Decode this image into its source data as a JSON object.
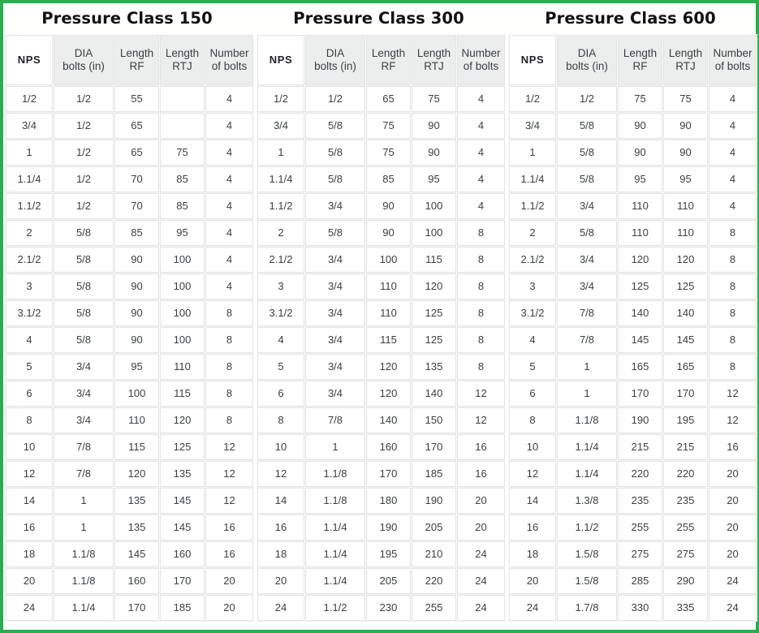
{
  "columns": [
    "NPS",
    "DIA bolts (in)",
    "Length RF",
    "Length RTJ",
    "Number of bolts"
  ],
  "column_lines": [
    {
      "line1": "NPS",
      "line2": ""
    },
    {
      "line1": "DIA",
      "line2": "bolts (in)"
    },
    {
      "line1": "Length",
      "line2": "RF"
    },
    {
      "line1": "Length",
      "line2": "RTJ"
    },
    {
      "line1": "Number",
      "line2": "of bolts"
    }
  ],
  "colors": {
    "page_border_green": "#28af4d",
    "header_background": "#eceded",
    "cell_border": "#e4e4e4",
    "text": "#3c4043",
    "title_text": "#111111"
  },
  "tables": [
    {
      "title": "Pressure Class 150",
      "rows": [
        [
          "1/2",
          "1/2",
          "55",
          "",
          "4"
        ],
        [
          "3/4",
          "1/2",
          "65",
          "",
          "4"
        ],
        [
          "1",
          "1/2",
          "65",
          "75",
          "4"
        ],
        [
          "1.1/4",
          "1/2",
          "70",
          "85",
          "4"
        ],
        [
          "1.1/2",
          "1/2",
          "70",
          "85",
          "4"
        ],
        [
          "2",
          "5/8",
          "85",
          "95",
          "4"
        ],
        [
          "2.1/2",
          "5/8",
          "90",
          "100",
          "4"
        ],
        [
          "3",
          "5/8",
          "90",
          "100",
          "4"
        ],
        [
          "3.1/2",
          "5/8",
          "90",
          "100",
          "8"
        ],
        [
          "4",
          "5/8",
          "90",
          "100",
          "8"
        ],
        [
          "5",
          "3/4",
          "95",
          "110",
          "8"
        ],
        [
          "6",
          "3/4",
          "100",
          "115",
          "8"
        ],
        [
          "8",
          "3/4",
          "110",
          "120",
          "8"
        ],
        [
          "10",
          "7/8",
          "115",
          "125",
          "12"
        ],
        [
          "12",
          "7/8",
          "120",
          "135",
          "12"
        ],
        [
          "14",
          "1",
          "135",
          "145",
          "12"
        ],
        [
          "16",
          "1",
          "135",
          "145",
          "16"
        ],
        [
          "18",
          "1.1/8",
          "145",
          "160",
          "16"
        ],
        [
          "20",
          "1.1/8",
          "160",
          "170",
          "20"
        ],
        [
          "24",
          "1.1/4",
          "170",
          "185",
          "20"
        ]
      ]
    },
    {
      "title": "Pressure Class 300",
      "rows": [
        [
          "1/2",
          "1/2",
          "65",
          "75",
          "4"
        ],
        [
          "3/4",
          "5/8",
          "75",
          "90",
          "4"
        ],
        [
          "1",
          "5/8",
          "75",
          "90",
          "4"
        ],
        [
          "1.1/4",
          "5/8",
          "85",
          "95",
          "4"
        ],
        [
          "1.1/2",
          "3/4",
          "90",
          "100",
          "4"
        ],
        [
          "2",
          "5/8",
          "90",
          "100",
          "8"
        ],
        [
          "2.1/2",
          "3/4",
          "100",
          "115",
          "8"
        ],
        [
          "3",
          "3/4",
          "110",
          "120",
          "8"
        ],
        [
          "3.1/2",
          "3/4",
          "110",
          "125",
          "8"
        ],
        [
          "4",
          "3/4",
          "115",
          "125",
          "8"
        ],
        [
          "5",
          "3/4",
          "120",
          "135",
          "8"
        ],
        [
          "6",
          "3/4",
          "120",
          "140",
          "12"
        ],
        [
          "8",
          "7/8",
          "140",
          "150",
          "12"
        ],
        [
          "10",
          "1",
          "160",
          "170",
          "16"
        ],
        [
          "12",
          "1.1/8",
          "170",
          "185",
          "16"
        ],
        [
          "14",
          "1.1/8",
          "180",
          "190",
          "20"
        ],
        [
          "16",
          "1.1/4",
          "190",
          "205",
          "20"
        ],
        [
          "18",
          "1.1/4",
          "195",
          "210",
          "24"
        ],
        [
          "20",
          "1.1/4",
          "205",
          "220",
          "24"
        ],
        [
          "24",
          "1.1/2",
          "230",
          "255",
          "24"
        ]
      ]
    },
    {
      "title": "Pressure Class 600",
      "rows": [
        [
          "1/2",
          "1/2",
          "75",
          "75",
          "4"
        ],
        [
          "3/4",
          "5/8",
          "90",
          "90",
          "4"
        ],
        [
          "1",
          "5/8",
          "90",
          "90",
          "4"
        ],
        [
          "1.1/4",
          "5/8",
          "95",
          "95",
          "4"
        ],
        [
          "1.1/2",
          "3/4",
          "110",
          "110",
          "4"
        ],
        [
          "2",
          "5/8",
          "110",
          "110",
          "8"
        ],
        [
          "2.1/2",
          "3/4",
          "120",
          "120",
          "8"
        ],
        [
          "3",
          "3/4",
          "125",
          "125",
          "8"
        ],
        [
          "3.1/2",
          "7/8",
          "140",
          "140",
          "8"
        ],
        [
          "4",
          "7/8",
          "145",
          "145",
          "8"
        ],
        [
          "5",
          "1",
          "165",
          "165",
          "8"
        ],
        [
          "6",
          "1",
          "170",
          "170",
          "12"
        ],
        [
          "8",
          "1.1/8",
          "190",
          "195",
          "12"
        ],
        [
          "10",
          "1.1/4",
          "215",
          "215",
          "16"
        ],
        [
          "12",
          "1.1/4",
          "220",
          "220",
          "20"
        ],
        [
          "14",
          "1.3/8",
          "235",
          "235",
          "20"
        ],
        [
          "16",
          "1.1/2",
          "255",
          "255",
          "20"
        ],
        [
          "18",
          "1.5/8",
          "275",
          "275",
          "20"
        ],
        [
          "20",
          "1.5/8",
          "285",
          "290",
          "24"
        ],
        [
          "24",
          "1.7/8",
          "330",
          "335",
          "24"
        ]
      ]
    }
  ]
}
